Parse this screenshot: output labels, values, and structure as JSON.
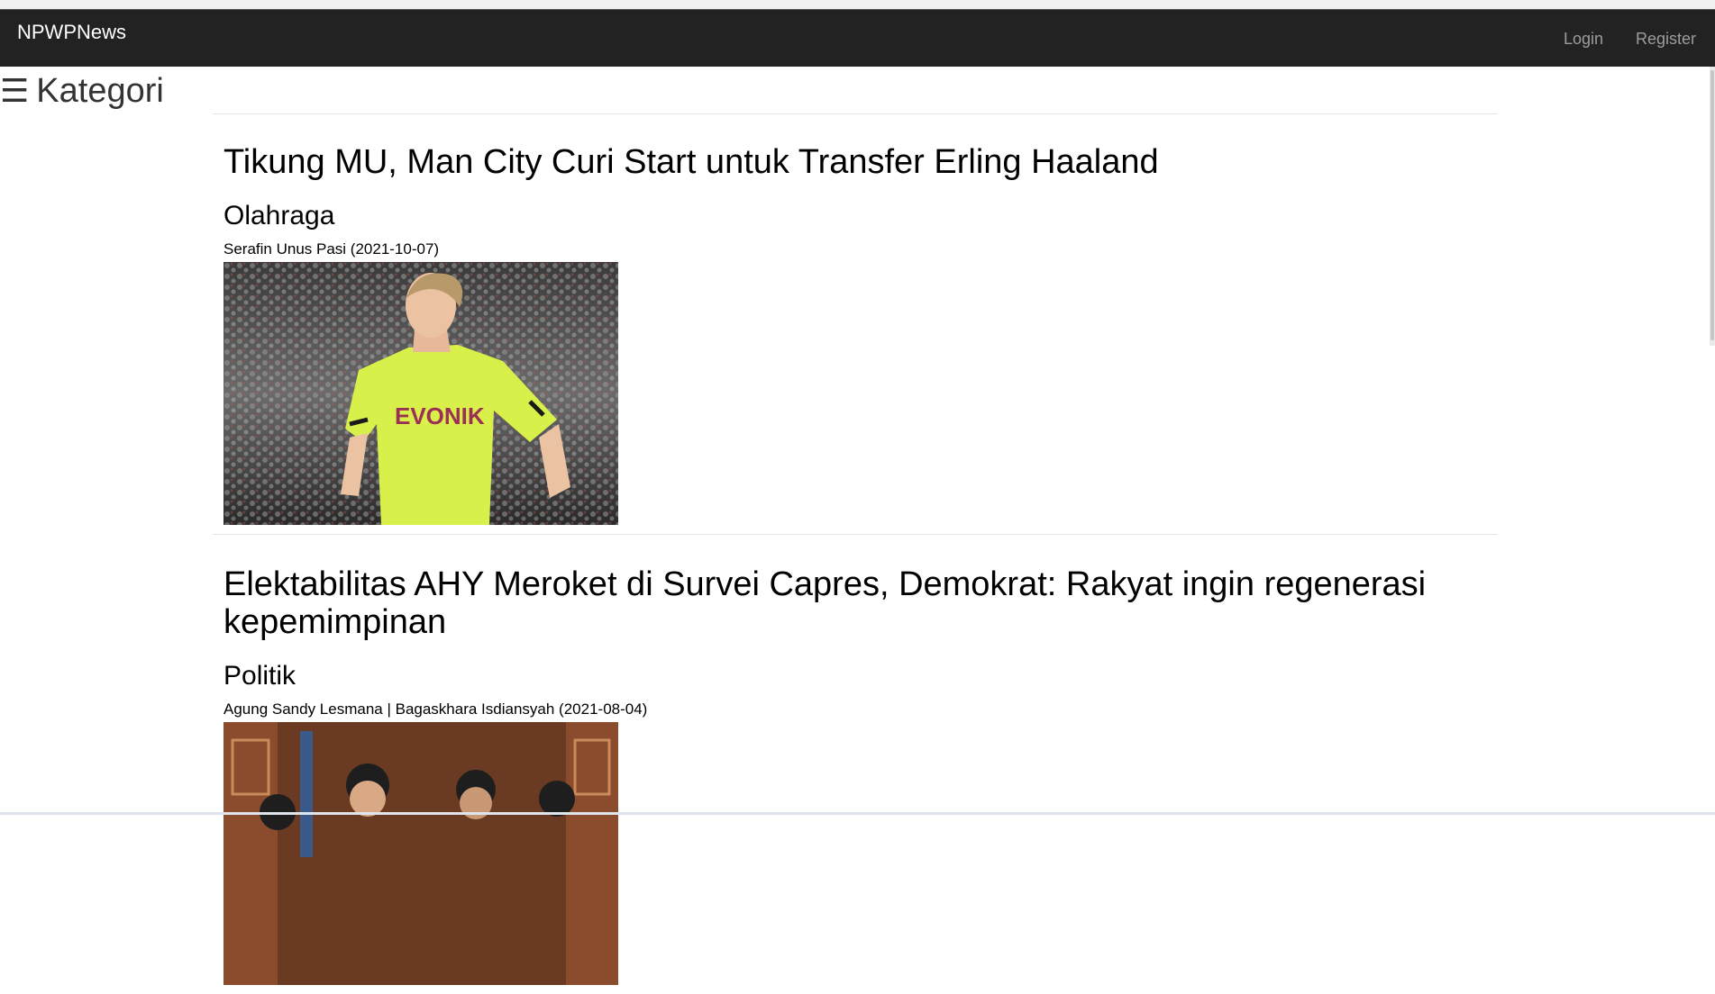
{
  "navbar": {
    "brand": "NPWPNews",
    "login_label": "Login",
    "register_label": "Register",
    "background": "#222222"
  },
  "sidebar": {
    "toggle_icon": "☰",
    "label": "Kategori"
  },
  "articles": [
    {
      "title": "Tikung MU, Man City Curi Start untuk Transfer Erling Haaland",
      "category": "Olahraga",
      "meta": "Serafin Unus Pasi (2021-10-07)",
      "image_subject": "footballer-in-yellow-training-shirt"
    },
    {
      "title": "Elektabilitas AHY Meroket di Survei Capres, Demokrat: Rakyat ingin regenerasi kepemimpinan",
      "category": "Politik",
      "meta": "Agung Sandy Lesmana | Bagaskhara Isdiansyah (2021-08-04)",
      "image_subject": "group-of-men-in-wooden-carved-room"
    }
  ]
}
